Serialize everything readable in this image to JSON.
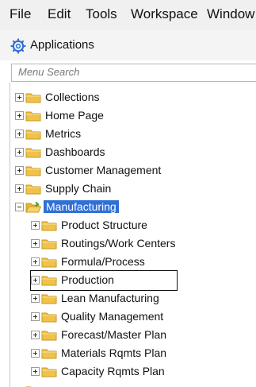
{
  "menubar": {
    "items": [
      "File",
      "Edit",
      "Tools",
      "Workspace",
      "Window"
    ]
  },
  "header": {
    "title": "Applications",
    "icon": "gear-icon"
  },
  "search": {
    "placeholder": "Menu Search"
  },
  "tree": {
    "items": [
      {
        "label": "Collections",
        "expander": "plus",
        "selected": false
      },
      {
        "label": "Home Page",
        "expander": "plus",
        "selected": false
      },
      {
        "label": "Metrics",
        "expander": "plus",
        "selected": false
      },
      {
        "label": "Dashboards",
        "expander": "plus",
        "selected": false
      },
      {
        "label": "Customer Management",
        "expander": "plus",
        "selected": false
      },
      {
        "label": "Supply Chain",
        "expander": "plus",
        "selected": false
      },
      {
        "label": "Manufacturing",
        "expander": "minus",
        "selected": true
      },
      {
        "label": "Product Structure",
        "expander": "plus",
        "selected": false
      },
      {
        "label": "Routings/Work Centers",
        "expander": "plus",
        "selected": false
      },
      {
        "label": "Formula/Process",
        "expander": "plus",
        "selected": false
      },
      {
        "label": "Production",
        "expander": "plus",
        "selected": false
      },
      {
        "label": "Lean Manufacturing",
        "expander": "plus",
        "selected": false
      },
      {
        "label": "Quality Management",
        "expander": "plus",
        "selected": false
      },
      {
        "label": "Forecast/Master Plan",
        "expander": "plus",
        "selected": false
      },
      {
        "label": "Materials Rqmts Plan",
        "expander": "plus",
        "selected": false
      },
      {
        "label": "Capacity Rqmts Plan",
        "expander": "plus",
        "selected": false
      }
    ]
  },
  "colors": {
    "selection": "#2f6fd6",
    "folder": "#f1c24a"
  }
}
